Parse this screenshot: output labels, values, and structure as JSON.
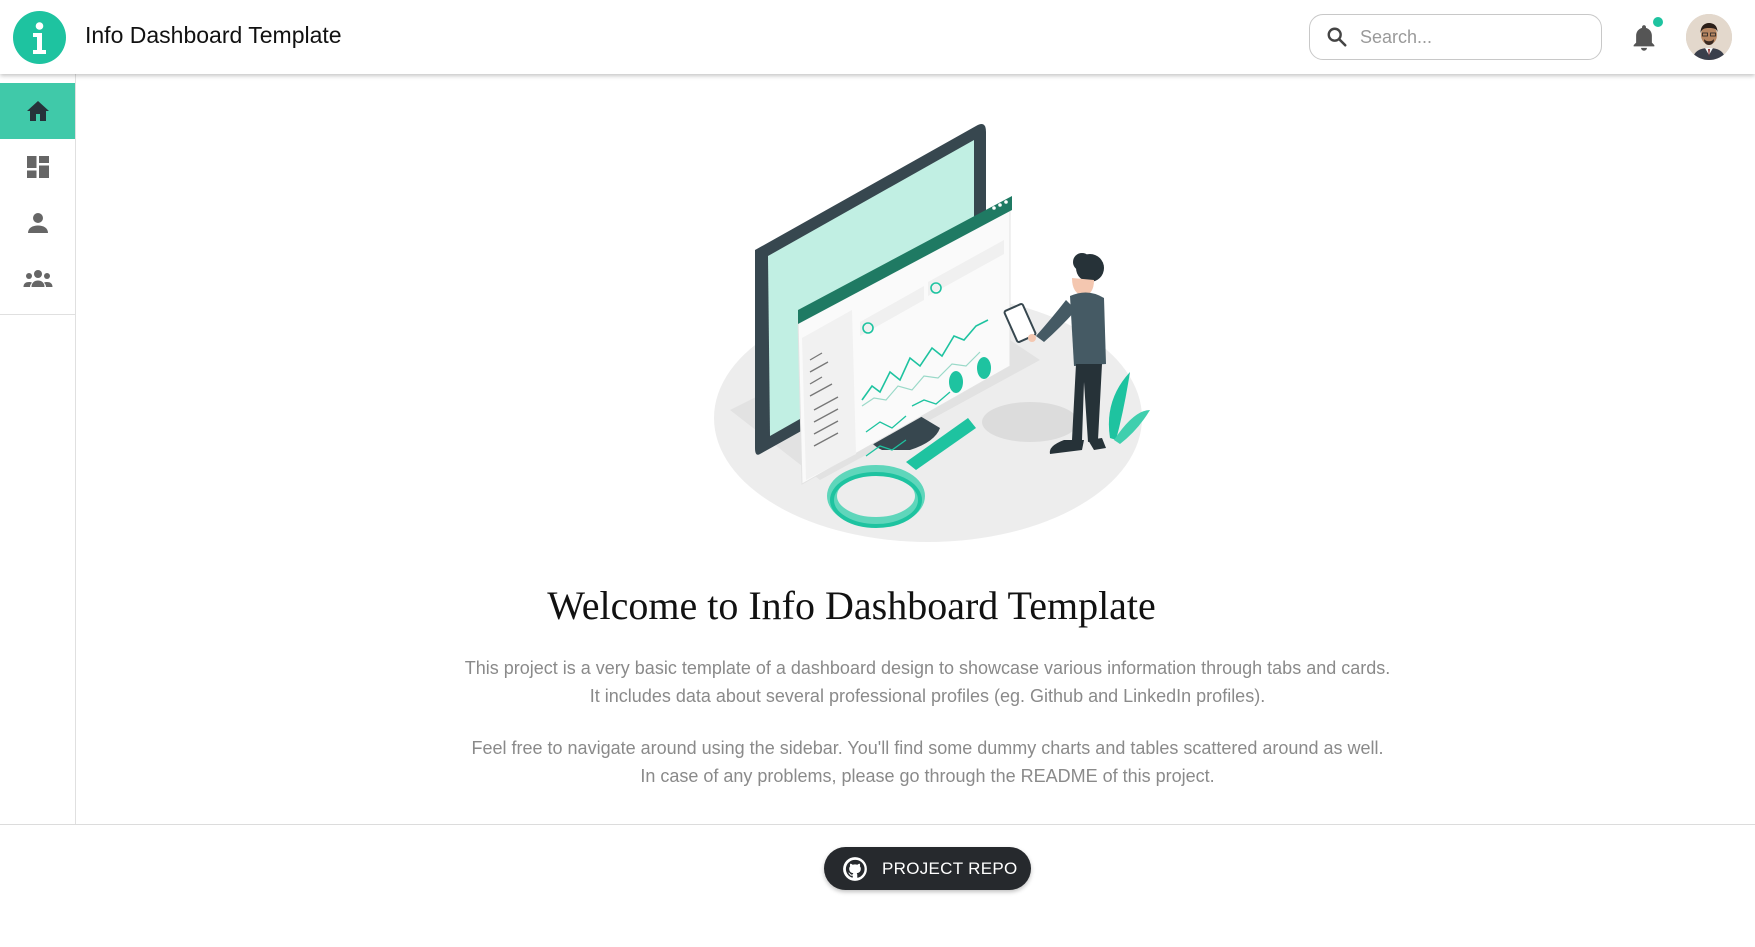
{
  "header": {
    "logo_glyph": "i",
    "title": "Info Dashboard Template",
    "search": {
      "placeholder": "Search...",
      "value": ""
    },
    "notifications": {
      "has_unread": true
    },
    "avatar": "user-avatar"
  },
  "sidebar": {
    "items": [
      {
        "icon": "home-icon",
        "active": true
      },
      {
        "icon": "dashboard-icon",
        "active": false
      },
      {
        "icon": "person-icon",
        "active": false
      },
      {
        "icon": "group-icon",
        "active": false
      }
    ]
  },
  "main": {
    "illustration": "dashboard-analytics-illustration",
    "heading": "Welcome to Info Dashboard Template",
    "paragraph1": [
      "This project is a very basic template of a dashboard design to showcase various information through tabs and cards.",
      "It includes data about several professional profiles (eg. Github and LinkedIn profiles)."
    ],
    "paragraph2": [
      "Feel free to navigate around using the sidebar. You'll find some dummy charts and tables scattered around as well.",
      "In case of any problems, please go through the README of this project."
    ]
  },
  "footer": {
    "repo_button_label": "PROJECT REPO",
    "repo_button_icon": "github-icon"
  },
  "colors": {
    "accent": "#1ec3a0",
    "sidebar_active": "#40c9a9",
    "button_dark": "#26292d",
    "muted_text": "#8a8a8a"
  }
}
